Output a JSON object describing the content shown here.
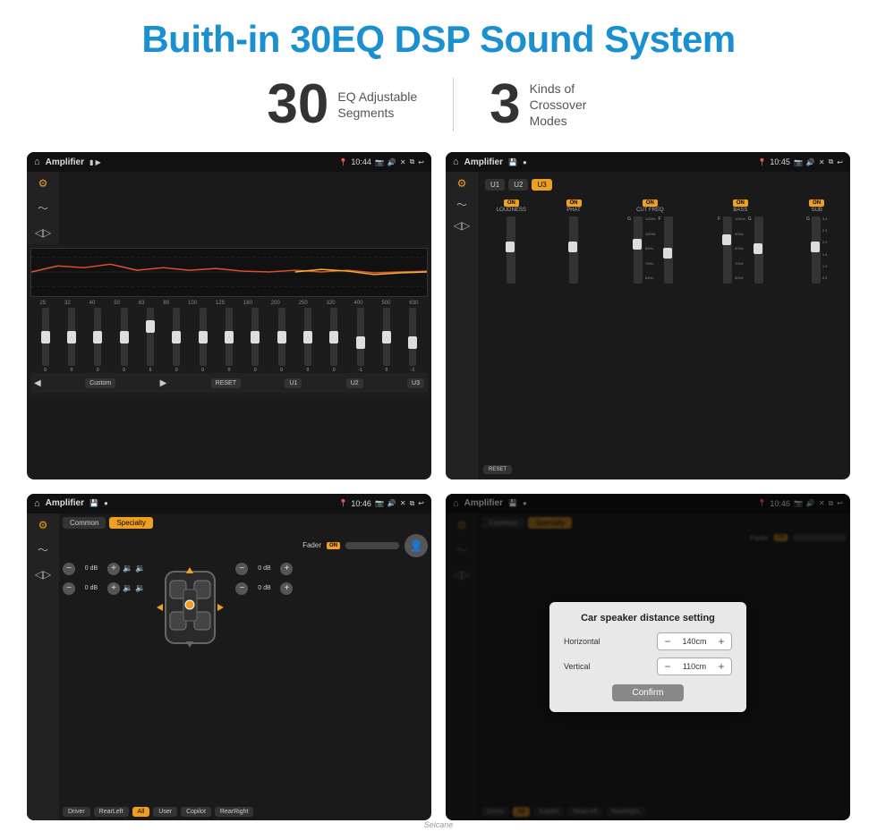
{
  "header": {
    "title": "Buith-in 30EQ DSP Sound System",
    "stat1_number": "30",
    "stat1_label": "EQ Adjustable\nSegments",
    "stat2_number": "3",
    "stat2_label": "Kinds of\nCrossover Modes"
  },
  "screen_tl": {
    "app": "Amplifier",
    "time": "10:44",
    "eq_labels": [
      "25",
      "32",
      "40",
      "50",
      "63",
      "80",
      "100",
      "125",
      "160",
      "200",
      "250",
      "320",
      "400",
      "500",
      "630"
    ],
    "eq_values": [
      "0",
      "0",
      "0",
      "0",
      "5",
      "0",
      "0",
      "0",
      "0",
      "0",
      "0",
      "0",
      "-1",
      "0",
      "-1"
    ],
    "mode_label": "Custom",
    "btn_reset": "RESET",
    "btn_u1": "U1",
    "btn_u2": "U2",
    "btn_u3": "U3"
  },
  "screen_tr": {
    "app": "Amplifier",
    "time": "10:45",
    "presets": [
      "U1",
      "U2",
      "U3"
    ],
    "active_preset": "U3",
    "channels": [
      {
        "on": true,
        "name": "LOUDNESS"
      },
      {
        "on": true,
        "name": "PHAT"
      },
      {
        "on": true,
        "name": "CUT FREQ"
      },
      {
        "on": true,
        "name": "BASS"
      },
      {
        "on": true,
        "name": "SUB"
      }
    ],
    "btn_reset": "RESET"
  },
  "screen_bl": {
    "app": "Amplifier",
    "time": "10:46",
    "tab_common": "Common",
    "tab_specialty": "Specialty",
    "fader_label": "Fader",
    "fader_on": "ON",
    "controls": [
      {
        "label": "0 dB"
      },
      {
        "label": "0 dB"
      },
      {
        "label": "0 dB"
      },
      {
        "label": "0 dB"
      }
    ],
    "btns": [
      "Driver",
      "RearLeft",
      "All",
      "User",
      "Copilot",
      "RearRight"
    ]
  },
  "screen_br": {
    "app": "Amplifier",
    "time": "10:46",
    "tab_common": "Common",
    "tab_specialty": "Specialty",
    "dialog": {
      "title": "Car speaker distance setting",
      "field1_label": "Horizontal",
      "field1_value": "140cm",
      "field2_label": "Vertical",
      "field2_value": "110cm",
      "confirm_btn": "Confirm"
    },
    "btns": [
      "Driver",
      "RearLeft",
      "Copilot",
      "RearRight"
    ]
  },
  "watermark": "Seicane"
}
